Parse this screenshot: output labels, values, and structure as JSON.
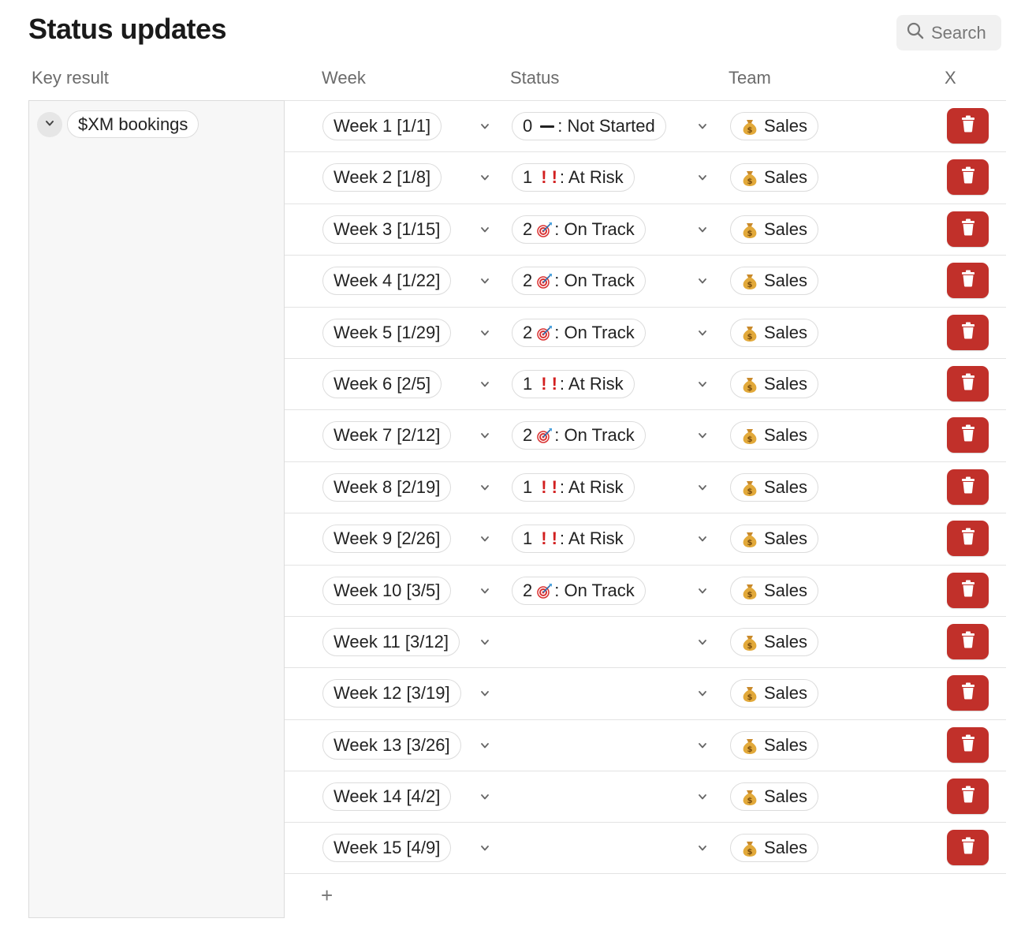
{
  "page": {
    "title": "Status updates"
  },
  "search": {
    "label": "Search"
  },
  "columns": {
    "key_result": "Key result",
    "week": "Week",
    "status": "Status",
    "team": "Team",
    "x": "X"
  },
  "key_result": {
    "label": "$XM bookings"
  },
  "team": {
    "label": "Sales",
    "icon": "money-bag-icon"
  },
  "colors": {
    "delete_button": "#c1302a",
    "at_risk": "#d21f1f"
  },
  "rows": [
    {
      "week": "Week 1 [1/1]",
      "status": {
        "num": "0",
        "icon": "dash",
        "label": ": Not Started"
      }
    },
    {
      "week": "Week 2 [1/8]",
      "status": {
        "num": "1",
        "icon": "bangs",
        "label": ": At Risk"
      }
    },
    {
      "week": "Week 3 [1/15]",
      "status": {
        "num": "2",
        "icon": "target",
        "label": ": On Track"
      }
    },
    {
      "week": "Week 4 [1/22]",
      "status": {
        "num": "2",
        "icon": "target",
        "label": ": On Track"
      }
    },
    {
      "week": "Week 5 [1/29]",
      "status": {
        "num": "2",
        "icon": "target",
        "label": ": On Track"
      }
    },
    {
      "week": "Week 6 [2/5]",
      "status": {
        "num": "1",
        "icon": "bangs",
        "label": ": At Risk"
      }
    },
    {
      "week": "Week 7 [2/12]",
      "status": {
        "num": "2",
        "icon": "target",
        "label": ": On Track"
      }
    },
    {
      "week": "Week 8 [2/19]",
      "status": {
        "num": "1",
        "icon": "bangs",
        "label": ": At Risk"
      }
    },
    {
      "week": "Week 9 [2/26]",
      "status": {
        "num": "1",
        "icon": "bangs",
        "label": ": At Risk"
      }
    },
    {
      "week": "Week 10 [3/5]",
      "status": {
        "num": "2",
        "icon": "target",
        "label": ": On Track"
      }
    },
    {
      "week": "Week 11 [3/12]",
      "status": null
    },
    {
      "week": "Week 12 [3/19]",
      "status": null
    },
    {
      "week": "Week 13 [3/26]",
      "status": null
    },
    {
      "week": "Week 14 [4/2]",
      "status": null
    },
    {
      "week": "Week 15 [4/9]",
      "status": null
    }
  ],
  "add_row": {
    "label": "+"
  }
}
